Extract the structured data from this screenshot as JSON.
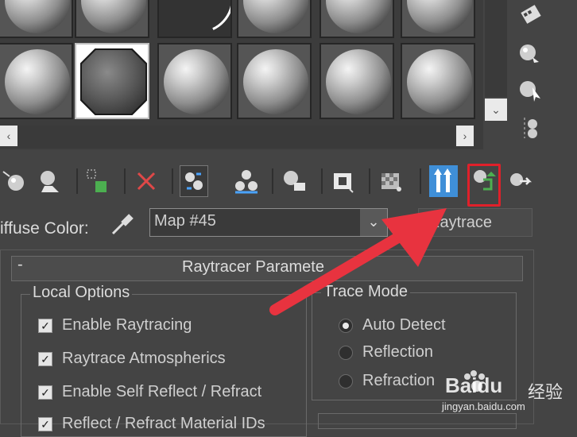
{
  "sample_slots": {
    "rows": [
      [
        "slot",
        "slot",
        "slot-reflect",
        "slot",
        "slot",
        "slot"
      ],
      [
        "slot",
        "slot-active",
        "slot",
        "slot",
        "slot",
        "slot"
      ]
    ]
  },
  "side_toolbar": {
    "icons": [
      "sample-type-icon",
      "backlight-icon",
      "background-icon",
      "sample-uv-icon"
    ]
  },
  "bottom_toolbar": {
    "icons": [
      "get-material-icon",
      "put-to-scene-icon",
      "assign-to-selection-icon",
      "delete-icon",
      "make-unique-icon",
      "copy-material-icon",
      "put-to-library-icon",
      "material-id-icon",
      "show-in-viewport-icon",
      "show-end-result-icon",
      "go-to-parent-icon",
      "go-forward-icon"
    ]
  },
  "diffuse": {
    "label": "iffuse Color:",
    "map_name": "Map #45",
    "map_type": "Raytrace"
  },
  "rollout": {
    "collapse_symbol": "-",
    "title": "Raytracer Paramete"
  },
  "local_options": {
    "title": "Local Options",
    "items": [
      {
        "label": "Enable Raytracing",
        "checked": true
      },
      {
        "label": "Raytrace Atmospherics",
        "checked": true
      },
      {
        "label": "Enable Self Reflect / Refract",
        "checked": true
      },
      {
        "label": "Reflect / Refract Material IDs",
        "checked": true
      }
    ]
  },
  "trace_mode": {
    "title": "Trace Mode",
    "options": [
      {
        "label": "Auto Detect",
        "selected": true
      },
      {
        "label": "Reflection",
        "selected": false
      },
      {
        "label": "Refraction",
        "selected": false
      }
    ]
  },
  "watermark": {
    "brand": "Bai",
    "brand2": "du",
    "cn": "经验",
    "url": "jingyan.baidu.com"
  },
  "colors": {
    "highlight": "#e0202a",
    "arrow": "#e8333f",
    "active_tool": "#3f8fd8"
  }
}
